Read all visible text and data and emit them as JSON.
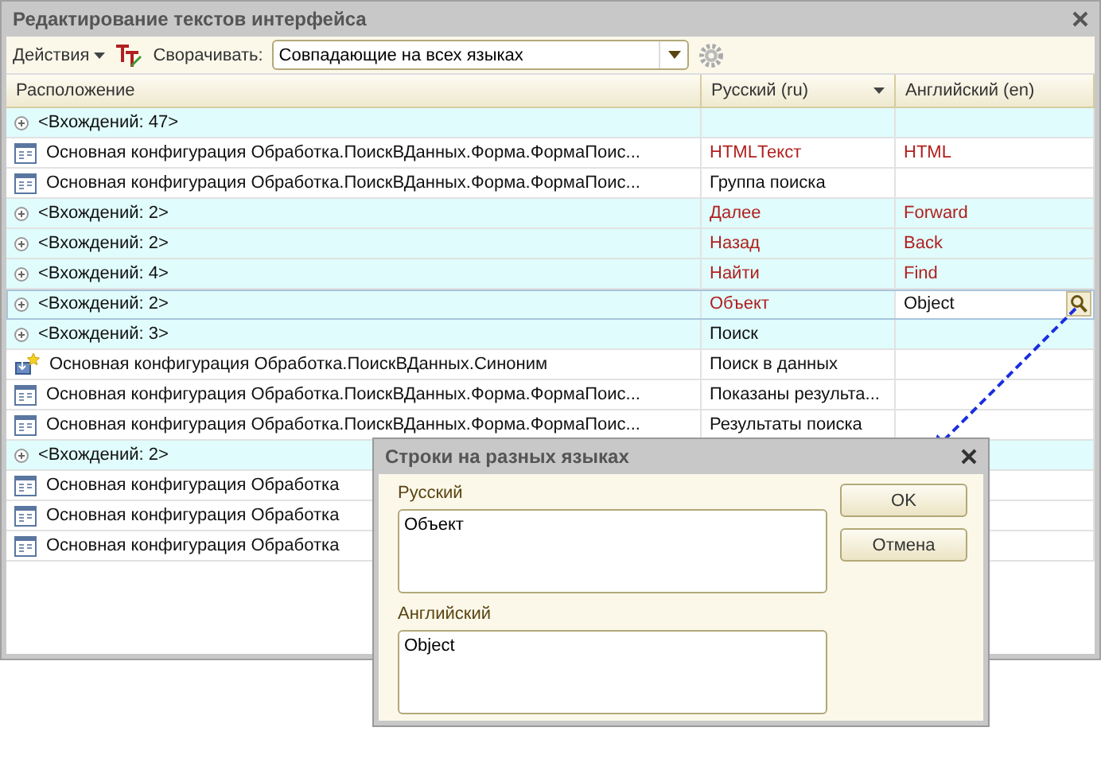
{
  "window": {
    "title": "Редактирование текстов интерфейса"
  },
  "toolbar": {
    "actions_label": "Действия",
    "collapse_label": "Сворачивать:",
    "collapse_value": "Совпадающие на всех языках"
  },
  "table": {
    "columns": [
      {
        "label": "Расположение",
        "sorted": false
      },
      {
        "label": "Русский (ru)",
        "sorted": true
      },
      {
        "label": "Английский (en)",
        "sorted": false
      }
    ],
    "rows": [
      {
        "kind": "group",
        "location": "<Вхождений: 47>",
        "ru": "",
        "en": "",
        "selected": false
      },
      {
        "kind": "form",
        "location": "Основная конфигурация Обработка.ПоискВДанных.Форма.ФормаПоис...",
        "ru": "HTMLТекст",
        "en": "HTML",
        "flagged": true,
        "selected": false
      },
      {
        "kind": "form",
        "location": "Основная конфигурация Обработка.ПоискВДанных.Форма.ФормаПоис...",
        "ru": "Группа поиска",
        "en": "",
        "flagged": false,
        "selected": false
      },
      {
        "kind": "group",
        "location": "<Вхождений: 2>",
        "ru": "Далее",
        "en": "Forward",
        "flagged": true,
        "selected": false
      },
      {
        "kind": "group",
        "location": "<Вхождений: 2>",
        "ru": "Назад",
        "en": "Back",
        "flagged": true,
        "selected": false
      },
      {
        "kind": "group",
        "location": "<Вхождений: 4>",
        "ru": "Найти",
        "en": "Find",
        "flagged": true,
        "selected": false
      },
      {
        "kind": "group",
        "location": "<Вхождений: 2>",
        "ru": "Объект",
        "en": "Object",
        "flagged": true,
        "selected": true
      },
      {
        "kind": "group",
        "location": "<Вхождений: 3>",
        "ru": "Поиск",
        "en": "",
        "flagged": false,
        "selected": false
      },
      {
        "kind": "attribute",
        "location": "Основная конфигурация Обработка.ПоискВДанных.Синоним",
        "ru": "Поиск в данных",
        "en": "",
        "flagged": false,
        "selected": false
      },
      {
        "kind": "form",
        "location": "Основная конфигурация Обработка.ПоискВДанных.Форма.ФормаПоис...",
        "ru": "Показаны результа...",
        "en": "",
        "flagged": false,
        "selected": false
      },
      {
        "kind": "form",
        "location": "Основная конфигурация Обработка.ПоискВДанных.Форма.ФормаПоис...",
        "ru": "Результаты поиска",
        "en": "",
        "flagged": false,
        "selected": false
      },
      {
        "kind": "group",
        "location": "<Вхождений: 2>",
        "ru": "",
        "en": "",
        "selected": false
      },
      {
        "kind": "form",
        "location": "Основная конфигурация Обработка",
        "ru": "",
        "en": "",
        "selected": false
      },
      {
        "kind": "form",
        "location": "Основная конфигурация Обработка",
        "ru": "",
        "en": "",
        "selected": false
      },
      {
        "kind": "form",
        "location": "Основная конфигурация Обработка",
        "ru": "",
        "en": "",
        "selected": false
      }
    ]
  },
  "dialog": {
    "title": "Строки на разных языках",
    "fields": [
      {
        "label": "Русский",
        "value": "Объект"
      },
      {
        "label": "Английский",
        "value": "Object"
      }
    ],
    "buttons": [
      "OK",
      "Отмена"
    ]
  }
}
